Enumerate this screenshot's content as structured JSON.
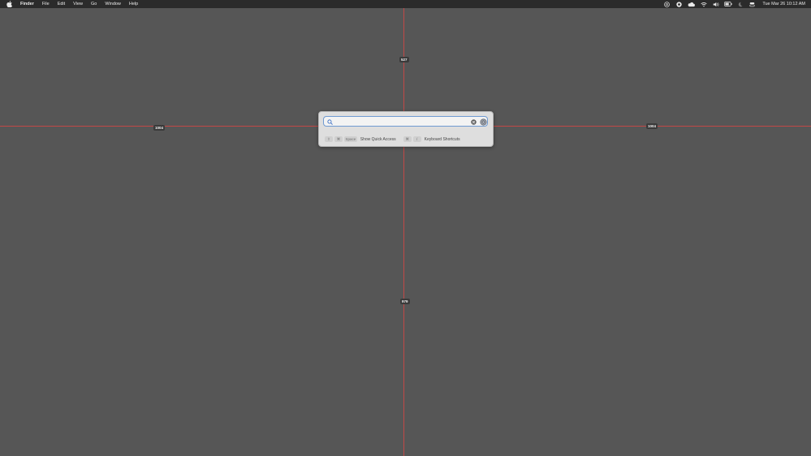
{
  "menubar": {
    "app_name": "Finder",
    "items": [
      "File",
      "Edit",
      "View",
      "Go",
      "Window",
      "Help"
    ],
    "status_icons": [
      "at-icon",
      "chat-icon",
      "cloud-icon",
      "wifi-icon",
      "volume-icon",
      "battery-icon",
      "moon-icon",
      "control-center-icon"
    ],
    "clock": "Tue Mar 26  10:12 AM"
  },
  "measurements": {
    "top": "527",
    "bottom": "979",
    "left": "1004",
    "right": "1004"
  },
  "search": {
    "value": "",
    "placeholder": ""
  },
  "hints": [
    {
      "keys": [
        "⇧",
        "⌘",
        "Space"
      ],
      "label": "Show Quick Access"
    },
    {
      "keys": [
        "⌘",
        "/"
      ],
      "label": "Keyboard Shortcuts"
    }
  ],
  "colors": {
    "desktop": "#565656",
    "guide_line": "#c24846",
    "search_border": "#6f9ad1"
  }
}
